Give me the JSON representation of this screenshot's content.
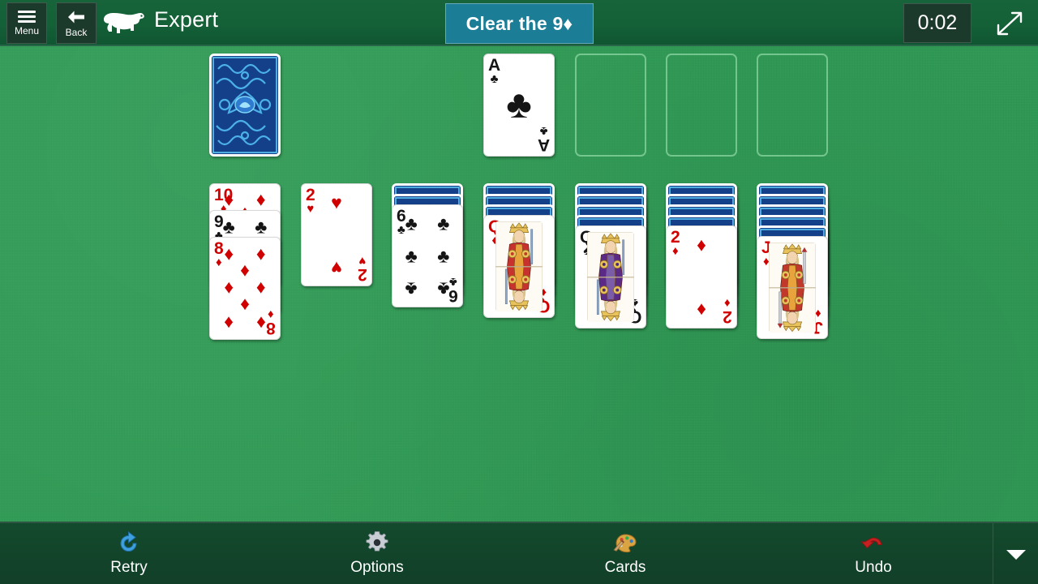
{
  "header": {
    "menu_label": "Menu",
    "menu_icon": "hamburger-icon",
    "back_label": "Back",
    "back_icon": "arrow-left-icon",
    "logo_icon": "polar-bear-icon",
    "title": "Expert",
    "objective": "Clear the 9♦",
    "timer": "0:02",
    "fullscreen_icon": "expand-diagonal-icon",
    "accent_banner_color": "#1C7D97",
    "header_bg_color": "#146037"
  },
  "table": {
    "felt_color": "#2E9B54",
    "stock": {
      "face_down": true,
      "label": "stock-pile"
    },
    "foundations": [
      {
        "card": {
          "rank": "A",
          "suit": "♣",
          "color": "black"
        },
        "empty": false
      },
      {
        "card": null,
        "empty": true
      },
      {
        "card": null,
        "empty": true
      },
      {
        "card": null,
        "empty": true
      }
    ],
    "tableau": [
      {
        "face_down": 0,
        "face_up": [
          {
            "rank": "10",
            "suit": "♦",
            "color": "red"
          },
          {
            "rank": "9",
            "suit": "♣",
            "color": "black"
          },
          {
            "rank": "8",
            "suit": "♦",
            "color": "red"
          }
        ]
      },
      {
        "face_down": 0,
        "face_up": [
          {
            "rank": "2",
            "suit": "♥",
            "color": "red"
          }
        ]
      },
      {
        "face_down": 2,
        "face_up": [
          {
            "rank": "6",
            "suit": "♣",
            "color": "black"
          }
        ]
      },
      {
        "face_down": 3,
        "face_up": [
          {
            "rank": "Q",
            "suit": "♦",
            "color": "red"
          }
        ]
      },
      {
        "face_down": 4,
        "face_up": [
          {
            "rank": "Q",
            "suit": "♠",
            "color": "black"
          }
        ]
      },
      {
        "face_down": 4,
        "face_up": [
          {
            "rank": "2",
            "suit": "♦",
            "color": "red"
          }
        ]
      },
      {
        "face_down": 5,
        "face_up": [
          {
            "rank": "J",
            "suit": "♦",
            "color": "red"
          }
        ]
      }
    ]
  },
  "bottom_bar": {
    "buttons": [
      {
        "label": "Retry",
        "icon": "retry-circular-arrow-icon",
        "color": "#3FA0DE"
      },
      {
        "label": "Options",
        "icon": "gear-icon",
        "color": "#C9CED4"
      },
      {
        "label": "Cards",
        "icon": "palette-icon",
        "color": "#D9A441"
      },
      {
        "label": "Undo",
        "icon": "undo-arrow-icon",
        "color": "#C62020"
      }
    ],
    "chevron_icon": "chevron-down-icon"
  }
}
